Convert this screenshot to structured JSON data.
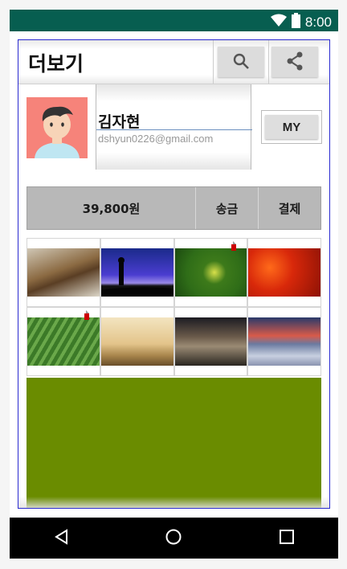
{
  "status": {
    "time": "8:00",
    "icons": [
      "wifi-icon",
      "battery-icon"
    ]
  },
  "toolbar": {
    "title": "더보기",
    "search_icon": "search-icon",
    "share_icon": "share-icon"
  },
  "profile": {
    "name": "김자현",
    "email": "dshyun0226@gmail.com",
    "my_button": "MY"
  },
  "payment": {
    "amount": "39,800원",
    "send_label": "송금",
    "pay_label": "결제"
  },
  "gallery": {
    "thumbnails": [
      {
        "name": "wood-closeup",
        "badge": false
      },
      {
        "name": "hiker-silhouette",
        "badge": false
      },
      {
        "name": "caterpillar",
        "badge": true
      },
      {
        "name": "red-maple-leaves",
        "badge": false
      },
      {
        "name": "tea-field-workers",
        "badge": true
      },
      {
        "name": "misty-mountains",
        "badge": false
      },
      {
        "name": "rocky-shore",
        "badge": false
      },
      {
        "name": "sunset-coast",
        "badge": false
      }
    ]
  },
  "colors": {
    "statusbar": "#075e50",
    "green_panel": "#6a8c00",
    "avatar_bg": "#f6837a"
  },
  "navbar": {
    "icons": [
      "back-icon",
      "home-icon",
      "recents-icon"
    ]
  }
}
